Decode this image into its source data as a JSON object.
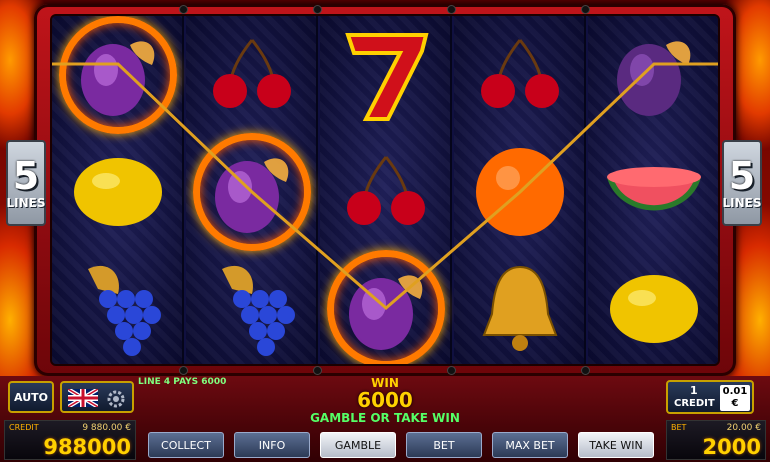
{
  "lines": {
    "count": "5",
    "label": "LINES"
  },
  "buttons": {
    "auto": "AUTO",
    "collect": "COLLECT",
    "info": "INFO",
    "gamble": "GAMBLE",
    "bet": "BET",
    "max_bet": "MAX BET",
    "take_win": "TAKE WIN"
  },
  "line_pays": "LINE 4 PAYS 6000",
  "win": {
    "label": "WIN",
    "amount": "6000",
    "prompt": "GAMBLE OR TAKE WIN"
  },
  "credit": {
    "label": "CREDIT",
    "money": "9 880.00 €",
    "value": "988000"
  },
  "bet": {
    "label": "BET",
    "money": "20.00 €",
    "value": "2000"
  },
  "denomination": {
    "count": "1",
    "label": "CREDIT",
    "value": "0.01",
    "currency": "€"
  },
  "language_flag": "uk-flag-icon",
  "settings_icon": "gear-icon",
  "colors": {
    "accent": "#ffd000",
    "frame": "#c0141a",
    "win_green": "#55ff66"
  },
  "reels": [
    [
      "plum",
      "lemon",
      "grapes"
    ],
    [
      "cherries",
      "plum",
      "grapes"
    ],
    [
      "seven",
      "cherries",
      "plum"
    ],
    [
      "cherries",
      "orange",
      "bell"
    ],
    [
      "plum",
      "watermelon",
      "lemon"
    ]
  ],
  "highlighted": "plums along line 4"
}
